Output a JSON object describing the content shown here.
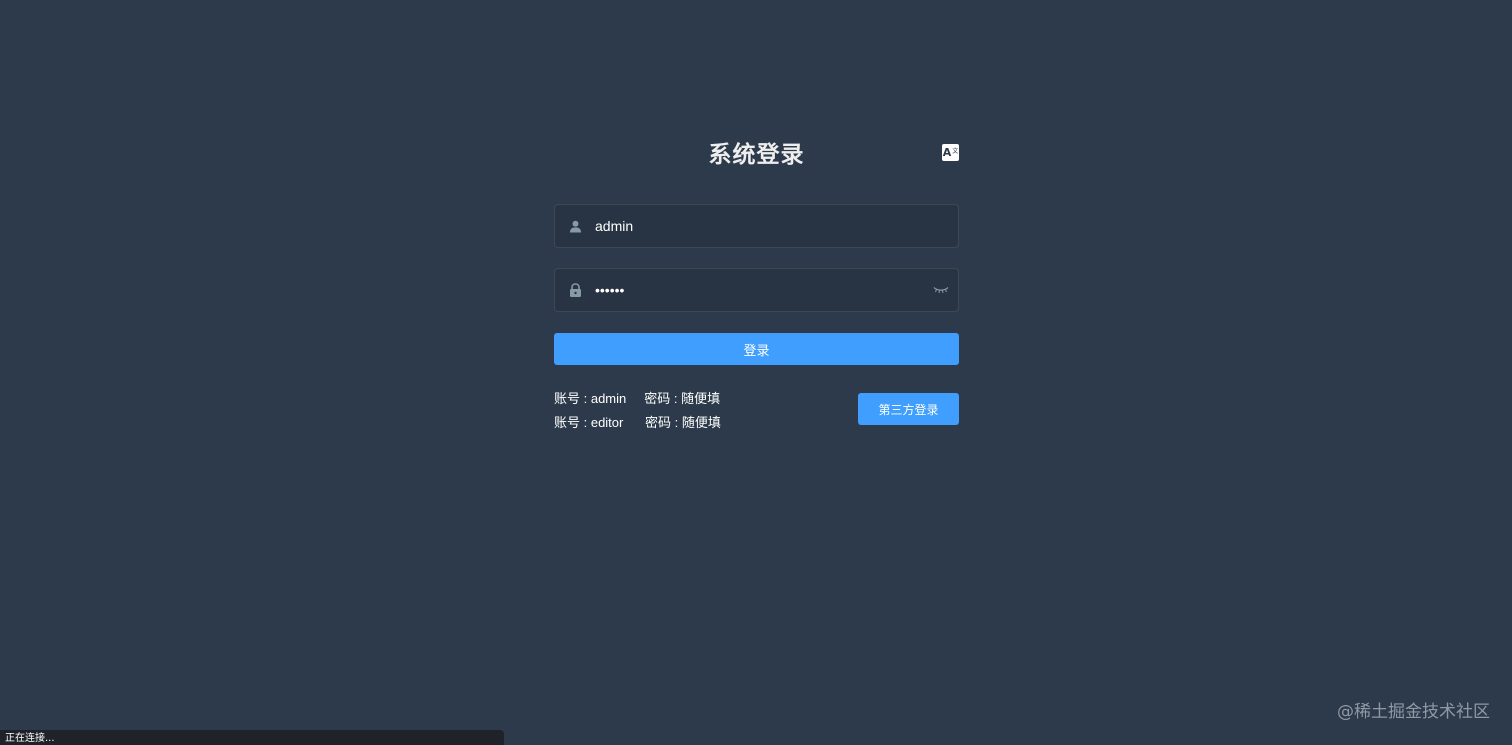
{
  "login": {
    "title": "系统登录",
    "lang_icon": "translate-icon",
    "username": {
      "value": "admin",
      "icon": "user-icon"
    },
    "password": {
      "value": "aaaaaa",
      "icon": "lock-icon",
      "toggle_icon": "eye-closed-icon"
    },
    "login_button": "登录",
    "tips": [
      "账号 : admin     密码 : 随便填",
      "账号 : editor      密码 : 随便填"
    ],
    "third_party_button": "第三方登录"
  },
  "status_bar": {
    "text": "正在连接..."
  },
  "watermark": "@稀土掘金技术社区",
  "colors": {
    "background": "#2d3a4b",
    "input_background": "#283443",
    "primary": "#409eff"
  }
}
